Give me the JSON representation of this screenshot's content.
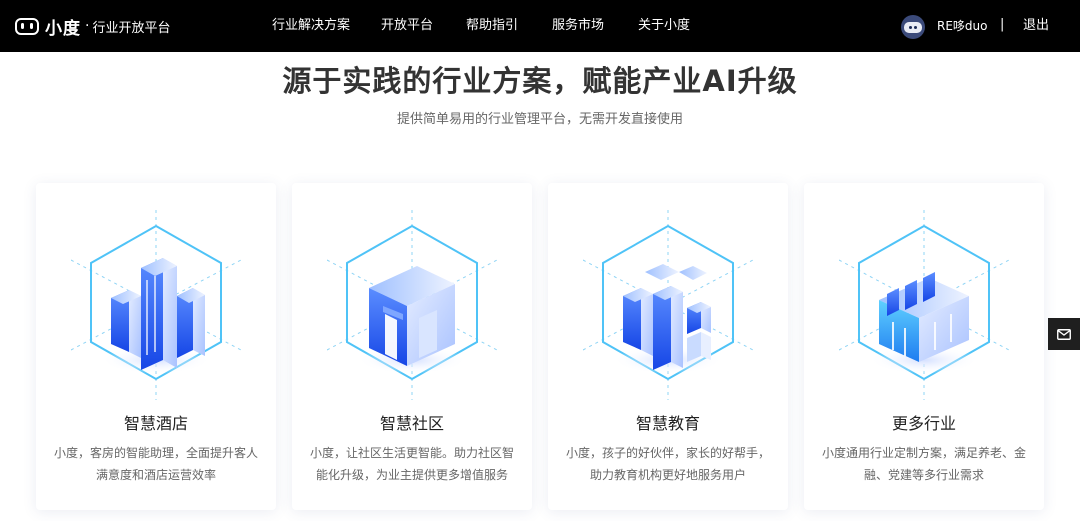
{
  "header": {
    "brand": "小度",
    "brand_separator": "·",
    "platform_name": "行业开放平台",
    "nav": [
      {
        "label": "行业解决方案"
      },
      {
        "label": "开放平台"
      },
      {
        "label": "帮助指引"
      },
      {
        "label": "服务市场"
      },
      {
        "label": "关于小度"
      }
    ],
    "username": "RE哆duo",
    "separator": "|",
    "logout_label": "退出"
  },
  "hero": {
    "title": "源于实践的行业方案，赋能产业AI升级",
    "subtitle": "提供简单易用的行业管理平台，无需开发直接使用"
  },
  "cards": [
    {
      "title": "智慧酒店",
      "desc": "小度，客房的智能助理，全面提升客人满意度和酒店运营效率",
      "icon": "hotel-building-icon"
    },
    {
      "title": "智慧社区",
      "desc": "小度，让社区生活更智能。助力社区智能化升级，为业主提供更多增值服务",
      "icon": "community-building-icon"
    },
    {
      "title": "智慧教育",
      "desc": "小度，孩子的好伙伴，家长的好帮手，助力教育机构更好地服务用户",
      "icon": "education-building-icon"
    },
    {
      "title": "更多行业",
      "desc": "小度通用行业定制方案，满足养老、金融、党建等多行业需求",
      "icon": "more-industries-icon"
    }
  ],
  "float": {
    "icon": "mail-icon"
  },
  "colors": {
    "header_bg": "#000000",
    "accent_blue": "#2f6cf6",
    "hex_outline": "#4fc3f7"
  }
}
